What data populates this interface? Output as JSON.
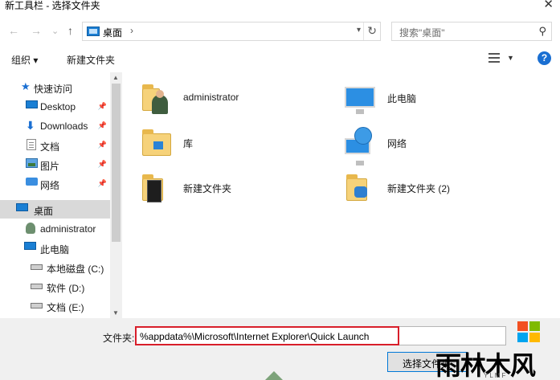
{
  "window": {
    "title": "新工具栏 - 选择文件夹",
    "close_glyph": "✕"
  },
  "nav": {
    "back_glyph": "←",
    "forward_glyph": "→",
    "recent_glyph": "⌄",
    "up_glyph": "↑",
    "address": "桌面",
    "address_sep": "›",
    "search_placeholder": "搜索\"桌面\""
  },
  "toolbar": {
    "organize_label": "组织 ▾",
    "new_folder_label": "新建文件夹",
    "help_label": "?"
  },
  "sidebar": {
    "items": [
      {
        "label": "快速访问",
        "icon": "star-icon"
      },
      {
        "label": "Desktop",
        "icon": "desktop-icon",
        "pinned": true
      },
      {
        "label": "Downloads",
        "icon": "downloads-icon",
        "pinned": true
      },
      {
        "label": "文档",
        "icon": "documents-icon",
        "pinned": true
      },
      {
        "label": "图片",
        "icon": "pictures-icon",
        "pinned": true
      },
      {
        "label": "网络",
        "icon": "network-icon",
        "pinned": true
      },
      {
        "label": "桌面",
        "icon": "desktop-icon",
        "selected": true
      },
      {
        "label": "administrator",
        "icon": "user-icon"
      },
      {
        "label": "此电脑",
        "icon": "computer-icon"
      },
      {
        "label": "本地磁盘 (C:)",
        "icon": "drive-icon"
      },
      {
        "label": "软件 (D:)",
        "icon": "drive-icon"
      },
      {
        "label": "文档 (E:)",
        "icon": "drive-icon"
      }
    ]
  },
  "files": [
    {
      "name": "administrator",
      "icon": "user-folder-icon"
    },
    {
      "name": "此电脑",
      "icon": "computer-icon"
    },
    {
      "name": "库",
      "icon": "library-folder-icon"
    },
    {
      "name": "网络",
      "icon": "network-icon"
    },
    {
      "name": "新建文件夹",
      "icon": "folder-icon"
    },
    {
      "name": "新建文件夹 (2)",
      "icon": "folder-icon"
    }
  ],
  "footer": {
    "folder_label": "文件夹:",
    "folder_value": "%appdata%\\Microsoft\\Internet Explorer\\Quick Launch",
    "select_button": "选择文件夹"
  },
  "watermark": {
    "text": "雨林木风",
    "sub": "YLMF"
  },
  "colors": {
    "accent": "#1a6fd2",
    "highlight_box": "#d81e2a",
    "selected_row": "#d9d9d9"
  }
}
